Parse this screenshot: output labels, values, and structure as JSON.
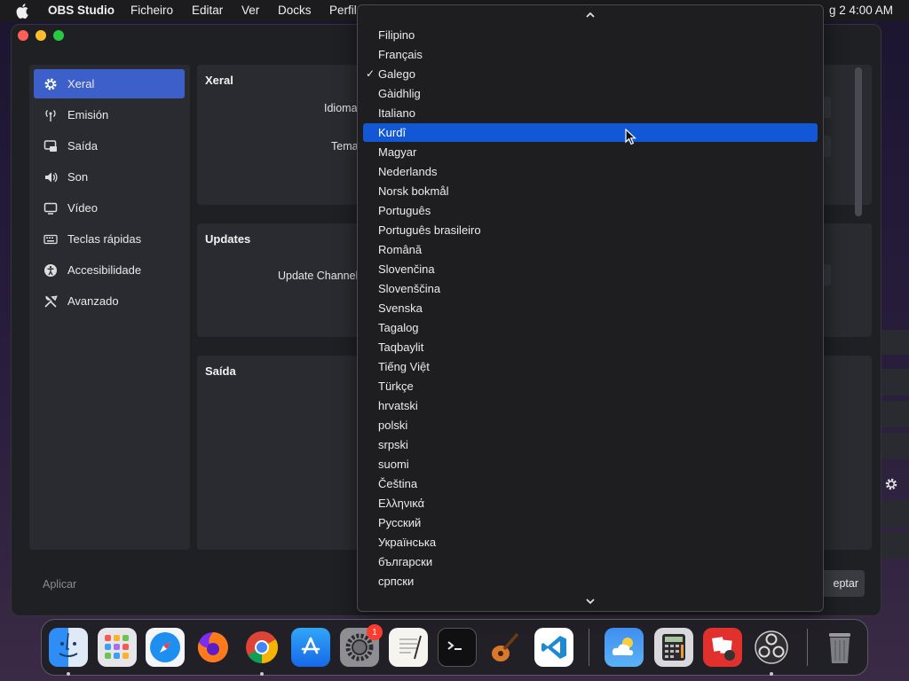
{
  "menubar": {
    "app_name": "OBS Studio",
    "items": [
      "Ficheiro",
      "Editar",
      "Ver",
      "Docks",
      "Perfil"
    ],
    "clock": "g 2  4:00 AM"
  },
  "sidebar": {
    "items": [
      {
        "label": "Xeral",
        "icon": "gear-icon",
        "active": true
      },
      {
        "label": "Emisión",
        "icon": "broadcast-icon",
        "active": false
      },
      {
        "label": "Saída",
        "icon": "output-icon",
        "active": false
      },
      {
        "label": "Son",
        "icon": "speaker-icon",
        "active": false
      },
      {
        "label": "Vídeo",
        "icon": "monitor-icon",
        "active": false
      },
      {
        "label": "Teclas rápidas",
        "icon": "keyboard-icon",
        "active": false
      },
      {
        "label": "Accesibilidade",
        "icon": "accessibility-icon",
        "active": false
      },
      {
        "label": "Avanzado",
        "icon": "tools-icon",
        "active": false
      }
    ]
  },
  "panels": {
    "general": {
      "title": "Xeral",
      "language_label": "Idioma",
      "theme_label": "Tema"
    },
    "updates": {
      "title": "Updates",
      "channel_label": "Update Channel"
    },
    "output": {
      "title": "Saída"
    }
  },
  "footer": {
    "apply_label": "Aplicar",
    "accept_label": "eptar"
  },
  "dropdown": {
    "selected": "Galego",
    "highlighted": "Kurdî",
    "items": [
      "Filipino",
      "Français",
      "Galego",
      "Gàidhlig",
      "Italiano",
      "Kurdî",
      "Magyar",
      "Nederlands",
      "Norsk bokmål",
      "Português",
      "Português brasileiro",
      "Română",
      "Slovenčina",
      "Slovenščina",
      "Svenska",
      "Tagalog",
      "Taqbaylit",
      "Tiếng Việt",
      "Türkçe",
      "hrvatski",
      "polski",
      "srpski",
      "suomi",
      "Čeština",
      "Ελληνικά",
      "Русский",
      "Українська",
      "български",
      "српски"
    ]
  },
  "dock": {
    "apps": [
      {
        "name": "finder-icon",
        "running": true
      },
      {
        "name": "launchpad-icon",
        "running": false
      },
      {
        "name": "safari-icon",
        "running": false
      },
      {
        "name": "firefox-icon",
        "running": false
      },
      {
        "name": "chrome-icon",
        "running": true
      },
      {
        "name": "app-store-icon",
        "running": false
      },
      {
        "name": "system-settings-icon",
        "running": false,
        "badge": "1"
      },
      {
        "name": "textedit-icon",
        "running": false
      },
      {
        "name": "terminal-icon",
        "running": false
      },
      {
        "name": "garageband-icon",
        "running": false
      },
      {
        "name": "vscode-icon",
        "running": false
      },
      {
        "name": "weather-icon",
        "running": false
      },
      {
        "name": "calculator-icon",
        "running": false
      },
      {
        "name": "photo-booth-icon",
        "running": false
      },
      {
        "name": "obs-icon",
        "running": true
      },
      {
        "name": "trash-icon",
        "running": false
      }
    ]
  },
  "colors": {
    "accent": "#3c5fc9",
    "highlight": "#1258d6",
    "window_bg": "#1f2024",
    "panel_bg": "#2a2b30"
  }
}
